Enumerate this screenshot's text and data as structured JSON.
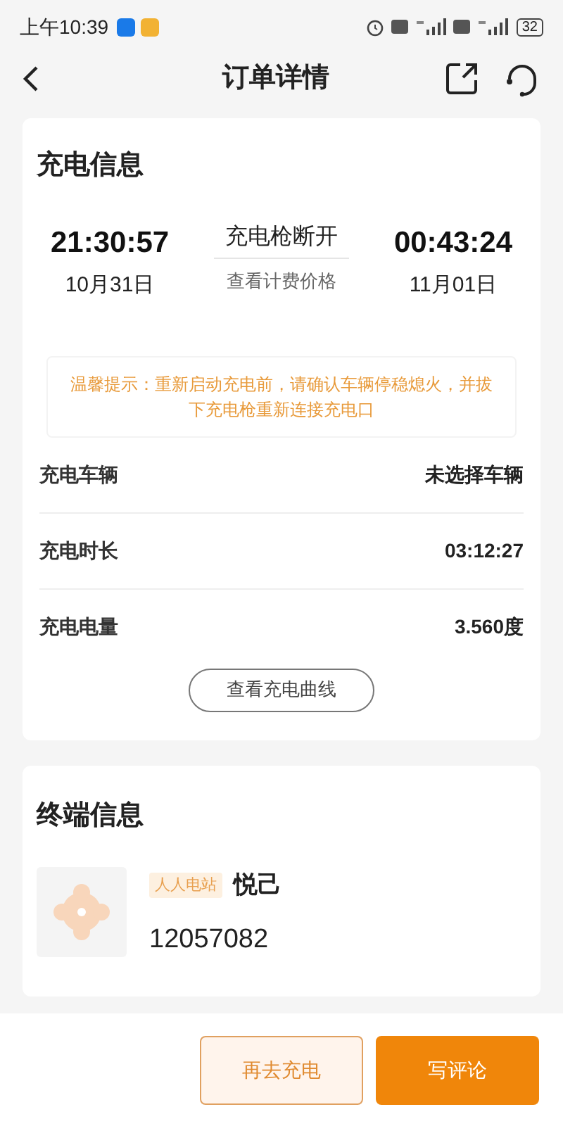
{
  "status_bar": {
    "time": "上午10:39",
    "battery": "32"
  },
  "header": {
    "title": "订单详情"
  },
  "charge_info": {
    "title": "充电信息",
    "start_time": "21:30:57",
    "start_date": "10月31日",
    "status": "充电枪断开",
    "price_link": "查看计费价格",
    "end_time": "00:43:24",
    "end_date": "11月01日",
    "tip": "温馨提示：重新启动充电前，请确认车辆停稳熄火，并拔下充电枪重新连接充电口",
    "rows": [
      {
        "label": "充电车辆",
        "value": "未选择车辆"
      },
      {
        "label": "充电时长",
        "value": "03:12:27"
      },
      {
        "label": "充电电量",
        "value": "3.560度"
      }
    ],
    "curve_button": "查看充电曲线"
  },
  "terminal_info": {
    "title": "终端信息",
    "tag": "人人电站",
    "name": "悦己",
    "number": "12057082"
  },
  "buttons": [
    {
      "label": "再去充电",
      "kind": "outline"
    },
    {
      "label": "写评论",
      "kind": "filled"
    }
  ]
}
